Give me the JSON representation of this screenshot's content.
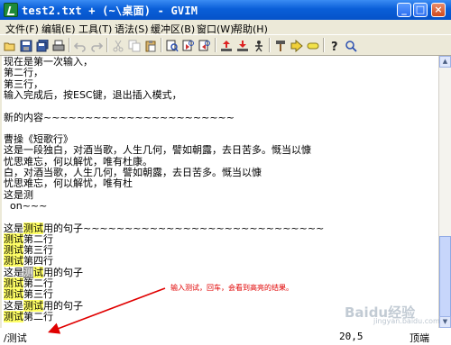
{
  "window": {
    "title": "test2.txt + (~\\桌面) - GVIM"
  },
  "menu": [
    "文件(F)",
    "编辑(E)",
    "工具(T)",
    "语法(S)",
    "缓冲区(B)",
    "窗口(W)",
    "帮助(H)"
  ],
  "toolbar_icons": [
    "open-icon",
    "save-icon",
    "save-all-icon",
    "print-icon",
    "undo-icon",
    "redo-icon",
    "cut-icon",
    "copy-icon",
    "paste-icon",
    "find-replace-icon",
    "find-next-icon",
    "find-prev-icon",
    "load-session-icon",
    "save-session-icon",
    "run-script-icon",
    "make-icon",
    "tags-icon",
    "find-help-icon",
    "help-icon"
  ],
  "editor": {
    "lines": [
      {
        "segments": [
          {
            "t": "现在是第一次输入，"
          }
        ]
      },
      {
        "segments": [
          {
            "t": "第二行，"
          }
        ]
      },
      {
        "segments": [
          {
            "t": "第三行，"
          }
        ]
      },
      {
        "segments": [
          {
            "t": "输入完成后，按ESC键，退出插入模式，"
          }
        ]
      },
      {
        "segments": [
          {
            "t": ""
          }
        ]
      },
      {
        "segments": [
          {
            "t": "新的内容~~~~~~~~~~~~~~~~~~~~~~~"
          }
        ]
      },
      {
        "segments": [
          {
            "t": ""
          }
        ]
      },
      {
        "segments": [
          {
            "t": "曹操《短歌行》"
          }
        ]
      },
      {
        "segments": [
          {
            "t": "这是一段独白，对酒当歌，人生几何，譬如朝露，去日苦多。慨当以慷"
          }
        ]
      },
      {
        "segments": [
          {
            "t": "忧思难忘，何以解忧，唯有杜康。"
          }
        ]
      },
      {
        "segments": [
          {
            "t": "白，对酒当歌，人生几何，譬如朝露，去日苦多。慨当以慷"
          }
        ]
      },
      {
        "segments": [
          {
            "t": "忧思难忘，何以解忧，唯有杜"
          }
        ]
      },
      {
        "segments": [
          {
            "t": "这是测"
          }
        ]
      },
      {
        "segments": [
          {
            "t": "  on~~~"
          }
        ]
      },
      {
        "segments": [
          {
            "t": ""
          }
        ]
      },
      {
        "segments": [
          {
            "t": "这是"
          },
          {
            "t": "测试",
            "hl": true
          },
          {
            "t": "用的句子~~~~~~~~~~~~~~~~~~~~~~~~~~~~~"
          }
        ]
      },
      {
        "segments": [
          {
            "t": "测试",
            "hl": true
          },
          {
            "t": "第二行"
          }
        ]
      },
      {
        "segments": [
          {
            "t": "测试",
            "hl": true
          },
          {
            "t": "第三行"
          }
        ]
      },
      {
        "segments": [
          {
            "t": "测试",
            "hl": true
          },
          {
            "t": "第四行"
          }
        ]
      },
      {
        "segments": [
          {
            "t": "这是"
          },
          {
            "t": "测",
            "cur": true
          },
          {
            "t": "试",
            "hl": true
          },
          {
            "t": "用的句子"
          }
        ]
      },
      {
        "segments": [
          {
            "t": "测试",
            "hl": true
          },
          {
            "t": "第二行"
          }
        ]
      },
      {
        "segments": [
          {
            "t": "测试",
            "hl": true
          },
          {
            "t": "第三行"
          }
        ]
      },
      {
        "segments": [
          {
            "t": "这是"
          },
          {
            "t": "测试",
            "hl": true
          },
          {
            "t": "用的句子"
          }
        ]
      },
      {
        "segments": [
          {
            "t": "测试",
            "hl": true
          },
          {
            "t": "第二行"
          }
        ]
      }
    ]
  },
  "annotation": {
    "text": "输入测试，回车，会看到高亮的结果。",
    "color": "#e00000"
  },
  "cmdline": {
    "command": "/测试",
    "position": "20,5",
    "scroll": "顶端"
  },
  "watermark": {
    "main": "Baidu经验",
    "sub": "jingyan.baidu.com"
  }
}
